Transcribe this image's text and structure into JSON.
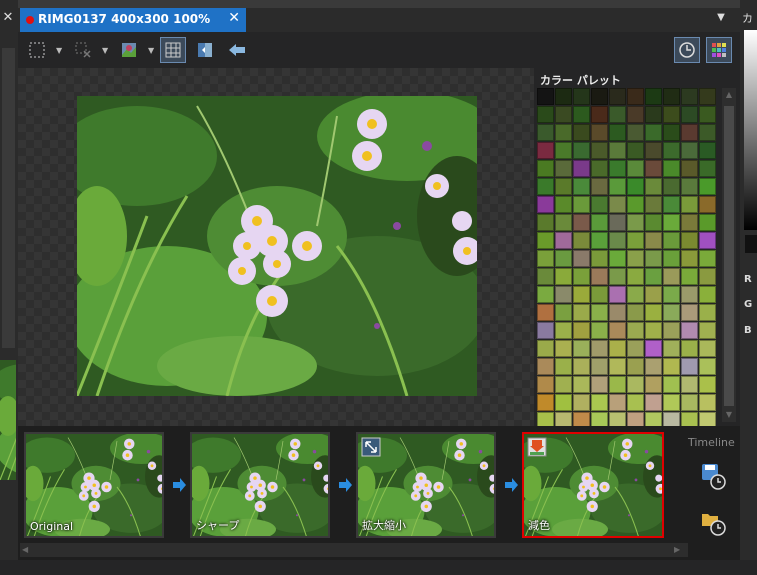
{
  "document_tab": {
    "title": "RIMG0137  400x300  100%",
    "close_icon": "close-icon",
    "modified_color": "#e01010"
  },
  "left_panel": {
    "close_icon": "close-icon"
  },
  "toolbar": {
    "icons": [
      "selection-rect-icon",
      "deselect-icon",
      "image-adjust-icon",
      "grid-icon",
      "compare-icon",
      "back-arrow-icon",
      "history-clock-icon",
      "palette-icon"
    ],
    "active_accent": "#6a8ab0"
  },
  "palette": {
    "title": "カラー パレット",
    "swatches": [
      "#141414",
      "#1c2a12",
      "#24361a",
      "#1a1a12",
      "#2a2a1c",
      "#3a2a1a",
      "#1c3a14",
      "#202c14",
      "#2c3a20",
      "#343a1c",
      "#2a4a1a",
      "#3a4a22",
      "#2c5a1e",
      "#4a2a1a",
      "#3a5a2a",
      "#4a3a28",
      "#2a3a1c",
      "#3c4c1c",
      "#2c4a24",
      "#3a5a20",
      "#3a5a2c",
      "#4a6a2a",
      "#3a4a1e",
      "#5a4a2a",
      "#2c5a20",
      "#4a5a32",
      "#3a6a2a",
      "#2a4c1a",
      "#5a3a30",
      "#3c5a28",
      "#7a2a40",
      "#4a7a2a",
      "#3a6a30",
      "#4a5a2a",
      "#5a7a3a",
      "#3a5a24",
      "#4a4a2c",
      "#3c6a2c",
      "#4a6a3a",
      "#2a5a24",
      "#4a7a22",
      "#5a6a3a",
      "#7a3a8a",
      "#4a6a2a",
      "#3a7a2c",
      "#5a8a3a",
      "#6a4a3a",
      "#4a8a2a",
      "#5a5a2a",
      "#3a6a28",
      "#3a7a2a",
      "#5a7a2a",
      "#4a8a3a",
      "#6a6a40",
      "#5a9a3a",
      "#3a8a2a",
      "#6a8a3a",
      "#4a6a30",
      "#5a7a3c",
      "#4a9a2a",
      "#8a3a9a",
      "#5a8a2a",
      "#6a9a3a",
      "#4a7a30",
      "#7a8a4a",
      "#5a9a2c",
      "#6a7a3a",
      "#4a8a38",
      "#7a9a3a",
      "#8a6a2a",
      "#5a7a2c",
      "#6a8a3a",
      "#7a5a4a",
      "#5a9a3a",
      "#6a6a5a",
      "#7a9a4a",
      "#5a8a30",
      "#6aaa3a",
      "#7a7a3a",
      "#5a9a2a",
      "#6a9a2a",
      "#a06a9a",
      "#7a8a3a",
      "#5aa03a",
      "#6a8a4a",
      "#7aa03a",
      "#8a8a4a",
      "#6a9a3a",
      "#7a8a30",
      "#a050c0",
      "#7aa03a",
      "#6a9a40",
      "#8a7a6a",
      "#7a9a3a",
      "#6aaa3a",
      "#8aa04a",
      "#7a9a4a",
      "#6aa03a",
      "#8a9a3a",
      "#7aaa3a",
      "#6a8a3a",
      "#8aaa3a",
      "#7aa03a",
      "#9a7a5a",
      "#7a9a4a",
      "#8aaa40",
      "#6aa040",
      "#9a9a5a",
      "#7aaa3a",
      "#8a9a40",
      "#7aaa40",
      "#8a8a6a",
      "#9aaa3a",
      "#7a9a3a",
      "#aa70b0",
      "#8aaa4a",
      "#9aa04a",
      "#7aaa4a",
      "#9a9a6a",
      "#8ab03a",
      "#b07040",
      "#7aa040",
      "#9aaa4a",
      "#8ab04a",
      "#9a8a6a",
      "#8a9a4a",
      "#9ab040",
      "#8aaa5a",
      "#aa9a7a",
      "#9ab04a",
      "#8a7aa0",
      "#9ab04a",
      "#a0a040",
      "#8ab04a",
      "#aa8a5a",
      "#9aaa50",
      "#a0b04a",
      "#9aa05a",
      "#b08ab0",
      "#a0b050",
      "#9aaa4a",
      "#aab050",
      "#9ab05a",
      "#a09a6a",
      "#aab04a",
      "#9aa05a",
      "#b060c8",
      "#a0b05a",
      "#9ab04a",
      "#aab85a",
      "#aa8a5a",
      "#9ab04a",
      "#aab05a",
      "#a0a06a",
      "#b0b85a",
      "#9aa050",
      "#aaa070",
      "#b0b850",
      "#a09ab0",
      "#aac05a",
      "#b08a4a",
      "#a0b050",
      "#aab85a",
      "#b0a07a",
      "#9ab84a",
      "#aab860",
      "#b0a060",
      "#a0c050",
      "#b0b870",
      "#aac04a",
      "#c08a2a",
      "#a0c040",
      "#b0b060",
      "#aac850",
      "#b8a07a",
      "#a8c050",
      "#c0a090",
      "#b0c858",
      "#a8b860",
      "#b8c060",
      "#a8c04a",
      "#b8b870",
      "#c08a4a",
      "#a8c858",
      "#b8c070",
      "#c0a080",
      "#b0c860",
      "#b8b8a0",
      "#a8c050",
      "#c0c870"
    ]
  },
  "right_panel": {
    "title": "カ",
    "r_label": "R",
    "g_label": "G",
    "b_label": "B"
  },
  "timeline": {
    "label": "Timeline",
    "items": [
      {
        "label": "Original",
        "selected": false
      },
      {
        "label": "シャープ",
        "selected": false
      },
      {
        "label": "拡大縮小",
        "selected": false,
        "icon": "resize-icon"
      },
      {
        "label": "減色",
        "selected": true,
        "icon": "color-reduce-icon"
      }
    ],
    "selected_color": "#e00000",
    "arrow_color": "#2a8de0",
    "actions": [
      "save-history-icon",
      "open-history-icon"
    ]
  }
}
